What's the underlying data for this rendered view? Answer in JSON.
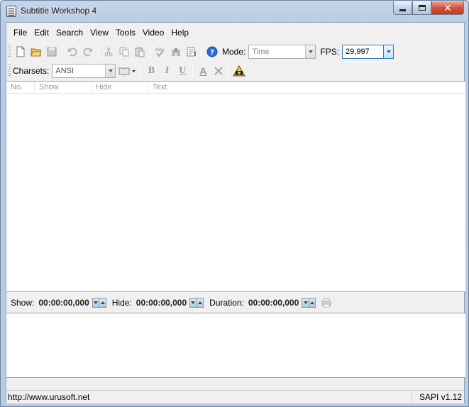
{
  "window": {
    "title": "Subtitle Workshop 4"
  },
  "menu": {
    "items": [
      "File",
      "Edit",
      "Search",
      "View",
      "Tools",
      "Video",
      "Help"
    ]
  },
  "toolbar": {
    "mode_label": "Mode:",
    "mode_value": "Time",
    "fps_label": "FPS:",
    "fps_value": "29,997",
    "charsets_label": "Charsets:",
    "charsets_value": "ANSI",
    "bold_letter": "B",
    "italic_letter": "I",
    "underline_letter": "U",
    "color_letter": "A"
  },
  "grid": {
    "columns": [
      "No.",
      "Show",
      "Hide",
      "Text"
    ]
  },
  "timebar": {
    "show_label": "Show:",
    "show_value": "00:00:00,000",
    "hide_label": "Hide:",
    "hide_value": "00:00:00,000",
    "duration_label": "Duration:",
    "duration_value": "00:00:00,000"
  },
  "status": {
    "left": "http://www.urusoft.net",
    "right": "SAPI v1.12"
  },
  "colors": {
    "accent": "#3c7fb1",
    "close_button": "#c23a22",
    "help_icon": "#2a6dd1"
  }
}
